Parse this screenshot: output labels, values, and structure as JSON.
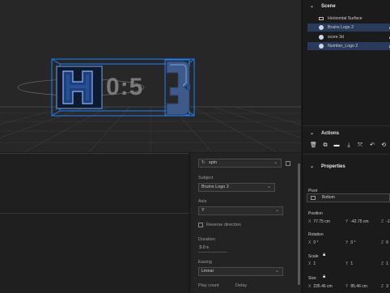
{
  "viewport": {
    "score_text": "0:5"
  },
  "editor": {
    "action_select": "spin",
    "subject_label": "Subject",
    "subject_value": "Bruins Logo 2",
    "axis_label": "Axis",
    "axis_value": "Y",
    "reverse_label": "Reverse direction",
    "duration_label": "Duration",
    "duration_value": "3.0 s",
    "easing_label": "Easing",
    "easing_value": "Linear",
    "play_count_label": "Play count",
    "delay_label": "Delay"
  },
  "scene": {
    "header": "Scene",
    "items": [
      {
        "label": "Horizontal Surface",
        "selected": false,
        "icon": "plane-icon",
        "locked": false
      },
      {
        "label": "Bruins Logo 2",
        "selected": true,
        "icon": "object-icon",
        "locked": true
      },
      {
        "label": "score 3d",
        "selected": false,
        "icon": "object-icon",
        "locked": true
      },
      {
        "label": "Number_Logo 2",
        "selected": true,
        "icon": "object-icon",
        "locked": true
      }
    ]
  },
  "actions": {
    "header": "Actions",
    "buttons": [
      "delete-icon",
      "duplicate-icon",
      "folder-icon",
      "import-icon",
      "transform-icon",
      "undo-icon",
      "redo-icon"
    ]
  },
  "properties": {
    "header": "Properties",
    "pivot_label": "Pivot",
    "pivot_value": "Bottom",
    "position_label": "Position",
    "position_x": "77.75 cm",
    "position_y": "-42.75 cm",
    "position_z": "-1",
    "rotation_label": "Rotation",
    "rotation_x": "0 °",
    "rotation_y": "0 °",
    "rotation_z": "0",
    "scale_label": "Scale",
    "scale_x": "1",
    "scale_y": "1",
    "scale_z": "1",
    "size_label": "Size",
    "size_x": "235.46 cm",
    "size_y": "85.46 cm",
    "size_z": "3"
  }
}
